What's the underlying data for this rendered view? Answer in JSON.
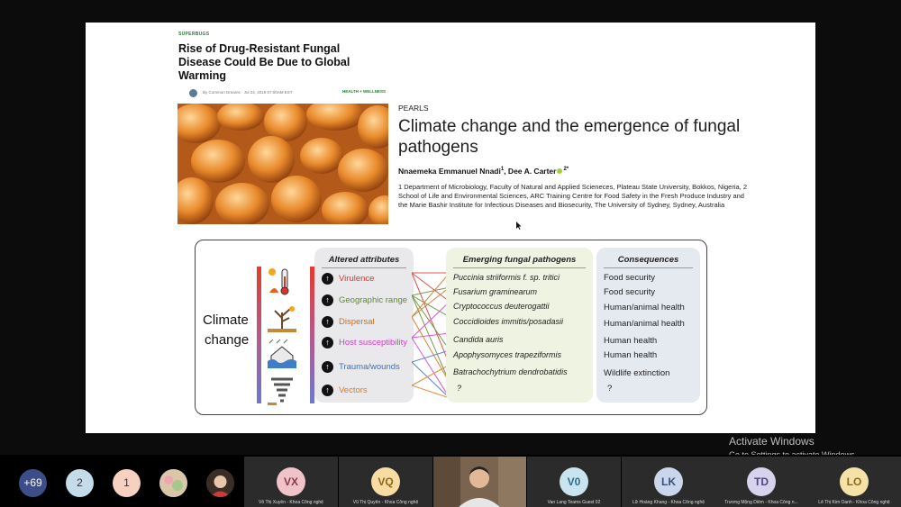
{
  "article": {
    "tag": "SUPERBUGS",
    "headline": "Rise of Drug-Resistant Fungal Disease Could Be Due to Global Warming",
    "byline": "By Common Dreams  ·  Jul 24, 2019 07:00AM EST",
    "section": "HEALTH + WELLNESS"
  },
  "paper": {
    "kicker": "PEARLS",
    "title": "Climate change and the emergence of fungal pathogens",
    "author1": "Nnaemeka Emmanuel Nnadi",
    "author1_sup": "1",
    "author_sep": ", Dee A. Carter",
    "author2_sup": "2*",
    "affiliations": "1  Department of Microbiology, Faculty of Natural and Applied Scieneces, Plateau State University, Bokkos, Nigeria, 2  School of Life and Environmental Sciences, ARC Training Centre for Food Safety in the Fresh Produce Industry and the Marie Bashir Institute for Infectious Diseases and Biosecurity, The University of Sydney, Sydney, Australia"
  },
  "diagram": {
    "left_label_1": "Climate",
    "left_label_2": "change",
    "headers": {
      "attributes": "Altered attributes",
      "pathogens": "Emerging fungal pathogens",
      "consequences": "Consequences"
    },
    "attributes": [
      {
        "label": "Virulence",
        "color": "#e0342a"
      },
      {
        "label": "Geographic range",
        "color": "#5e8a2c"
      },
      {
        "label": "Dispersal",
        "color": "#d86a12"
      },
      {
        "label": "Host susceptibility",
        "color": "#d23cc8"
      },
      {
        "label": "Trauma/wounds",
        "color": "#3f6fc6"
      },
      {
        "label": "Vectors",
        "color": "#e0781e"
      }
    ],
    "pathogens": [
      "Puccinia striiformis f. sp. tritici",
      "Fusarium graminearum",
      "Cryptococcus deuterogattii",
      "Coccidioides immitis/posadasii",
      "Candida auris",
      "Apophysomyces trapeziformis",
      "Batrachochytrium dendrobatidis",
      "?"
    ],
    "consequences": [
      "Food security",
      "Food security",
      "Human/animal health",
      "Human/animal health",
      "Human health",
      "Human health",
      "Wildlife extinction",
      "?"
    ],
    "up_glyph": "↑"
  },
  "participants": {
    "overflow": {
      "label": "+69",
      "color": "#3d4d8a"
    },
    "circles": [
      {
        "label": "2",
        "color": "#c6dbe9"
      },
      {
        "label": "1",
        "color": "#f6d1c2"
      }
    ],
    "tiles": [
      {
        "initials": "VX",
        "name": "Võ Thị Xuyến - Khoa Công nghệ",
        "color": "#f0c3c8"
      },
      {
        "initials": "VQ",
        "name": "Vũ Thị Quyên - Khoa Công nghệ",
        "color": "#f7dca4"
      },
      {
        "initials": "V0",
        "name": "Van Lang Teams Guest 02",
        "color": "#c9e3ef"
      },
      {
        "initials": "LK",
        "name": "Lữ Hoàng Khang - Khoa Công nghệ",
        "color": "#c9d6ec"
      },
      {
        "initials": "TD",
        "name": "Trương Mộng Diễm - Khoa Công n...",
        "color": "#d7d3ec"
      },
      {
        "initials": "LO",
        "name": "Lê Thị Kim Oanh - Khoa Công nghệ",
        "color": "#f6e2a8"
      }
    ]
  },
  "watermark": {
    "line1": "Activate Windows",
    "line2": "Go to Settings to activate Windows."
  }
}
